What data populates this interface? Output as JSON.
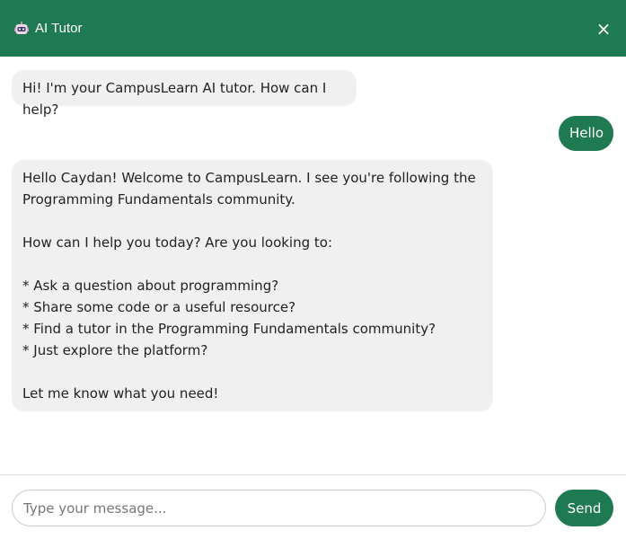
{
  "header": {
    "icon": "robot-icon",
    "title": "AI Tutor",
    "close_label": "×"
  },
  "messages": [
    {
      "role": "bot",
      "text": "Hi! I'm your CampusLearn AI tutor. How can I help?"
    },
    {
      "role": "user",
      "text": "Hello"
    },
    {
      "role": "bot",
      "text": "Hello Caydan! Welcome to CampusLearn. I see you're following the Programming Fundamentals community.\n\nHow can I help you today? Are you looking to:\n\n* Ask a question about programming?\n* Share some code or a useful resource?\n* Find a tutor in the Programming Fundamentals community?\n* Just explore the platform?\n\nLet me know what you need!"
    }
  ],
  "composer": {
    "placeholder": "Type your message...",
    "value": "",
    "send_label": "Send"
  },
  "colors": {
    "accent": "#1f7a52",
    "bot_bubble": "#f0f0f0"
  }
}
